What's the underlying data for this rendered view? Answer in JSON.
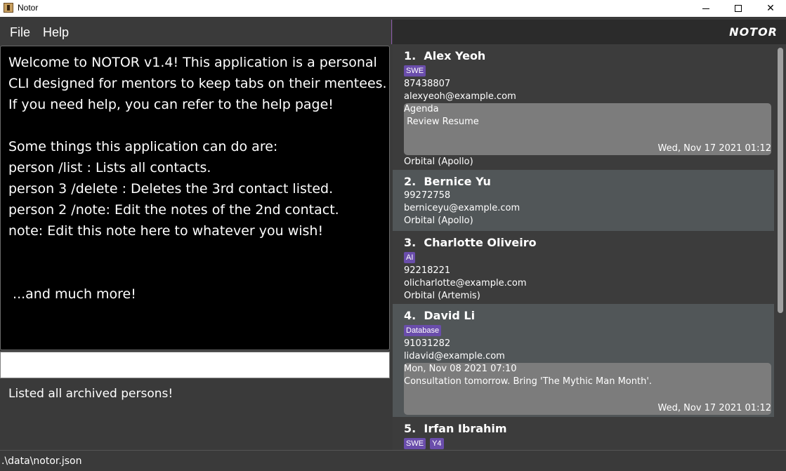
{
  "window": {
    "title": "Notor",
    "icon": "notor-app-icon",
    "controls": {
      "minimize": "minimize-icon",
      "maximize": "maximize-icon",
      "close": "close-icon",
      "close_glyph": "✕"
    }
  },
  "menu": {
    "file": "File",
    "help": "Help",
    "brand": "NOTOR"
  },
  "note_panel": {
    "lines": [
      "Welcome to NOTOR v1.4! This application is a personal",
      "CLI designed for mentors to keep tabs on their mentees.",
      "If you need help, you can refer to the help page!",
      "",
      "Some things this application can do are:",
      "person /list : Lists all contacts.",
      "person 3 /delete : Deletes the 3rd contact listed.",
      "person 2 /note: Edit the notes of the 2nd contact.",
      "note: Edit this note here to whatever you wish!",
      "",
      "",
      " ...and much more!"
    ]
  },
  "command_box": {
    "value": "",
    "placeholder": ""
  },
  "result_display": "Listed all archived persons!",
  "persons": [
    {
      "index": "1.",
      "name": "Alex Yeoh",
      "tags": [
        "SWE"
      ],
      "phone": "87438807",
      "email": "alexyeoh@example.com",
      "note_lines": [
        "Agenda",
        " Review Resume"
      ],
      "note_date": "Wed, Nov 17 2021 01:12",
      "group": "Orbital (Apollo)"
    },
    {
      "index": "2.",
      "name": "Bernice Yu",
      "tags": [],
      "phone": "99272758",
      "email": "berniceyu@example.com",
      "group": "Orbital (Apollo)"
    },
    {
      "index": "3.",
      "name": "Charlotte Oliveiro",
      "tags": [
        "AI"
      ],
      "phone": "92218221",
      "email": "olicharlotte@example.com",
      "group": "Orbital (Artemis)"
    },
    {
      "index": "4.",
      "name": "David Li",
      "tags": [
        "Database"
      ],
      "phone": "91031282",
      "email": "lidavid@example.com",
      "note_lines": [
        "Mon, Nov 08 2021 07:10",
        "Consultation tomorrow. Bring 'The Mythic Man Month'."
      ],
      "note_date": "Wed, Nov 17 2021 01:12"
    },
    {
      "index": "5.",
      "name": "Irfan Ibrahim",
      "tags": [
        "SWE",
        "Y4"
      ]
    }
  ],
  "status_bar": ".\\data\\notor.json",
  "colors": {
    "tag": "#6a4dab",
    "note_bubble": "#7c7c7c",
    "card_light": "#515658",
    "card_dark": "#3c3c3c"
  }
}
